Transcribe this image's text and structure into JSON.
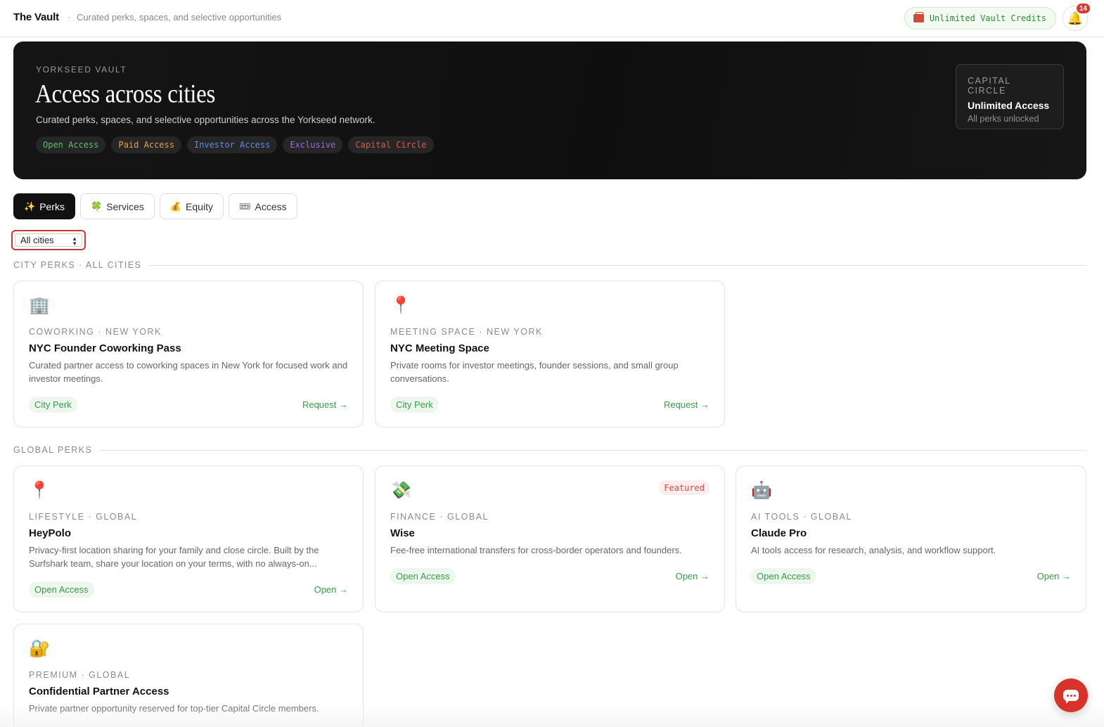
{
  "header": {
    "brand": "The Vault",
    "separator": ".",
    "tagline": "Curated perks, spaces, and selective opportunities",
    "credits_label": "Unlimited Vault Credits",
    "notification_count": "14"
  },
  "hero": {
    "kicker": "YORKSEED VAULT",
    "title": "Access across cities",
    "subtitle": "Curated perks, spaces, and selective opportunities across the Yorkseed network.",
    "tags": [
      "Open Access",
      "Paid Access",
      "Investor Access",
      "Exclusive",
      "Capital Circle"
    ],
    "tier": {
      "label": "CAPITAL CIRCLE",
      "title": "Unlimited Access",
      "subtitle": "All perks unlocked"
    }
  },
  "tabs": [
    {
      "icon": "✨",
      "label": "Perks",
      "active": true
    },
    {
      "icon": "🍀",
      "label": "Services",
      "active": false
    },
    {
      "icon": "💰",
      "label": "Equity",
      "active": false
    },
    {
      "icon": "🎟",
      "label": "Access",
      "active": false
    }
  ],
  "filter": {
    "city_selected": "All cities"
  },
  "sections": {
    "city": "CITY PERKS · ALL CITIES",
    "global": "GLOBAL PERKS"
  },
  "city_perks": [
    {
      "icon": "🏢",
      "category": "COWORKING · NEW YORK",
      "title": "NYC Founder Coworking Pass",
      "description": "Curated partner access to coworking spaces in New York for focused work and investor meetings.",
      "pill": "City Perk",
      "action": "Request →"
    },
    {
      "icon": "📍",
      "category": "MEETING SPACE · NEW YORK",
      "title": "NYC Meeting Space",
      "description": "Private rooms for investor meetings, founder sessions, and small group conversations.",
      "pill": "City Perk",
      "action": "Request →"
    }
  ],
  "global_perks": [
    {
      "icon": "📍",
      "category": "LIFESTYLE · GLOBAL",
      "title": "HeyPolo",
      "description": "Privacy-first location sharing for your family and close circle. Built by the Surfshark team, share your location on your terms, with no always-on...",
      "pill": "Open Access",
      "action": "Open →",
      "featured": ""
    },
    {
      "icon": "💸",
      "category": "FINANCE · GLOBAL",
      "title": "Wise",
      "description": "Fee-free international transfers for cross-border operators and founders.",
      "pill": "Open Access",
      "action": "Open →",
      "featured": "Featured"
    },
    {
      "icon": "🤖",
      "category": "AI TOOLS · GLOBAL",
      "title": "Claude Pro",
      "description": "AI tools access for research, analysis, and workflow support.",
      "pill": "Open Access",
      "action": "Open →",
      "featured": ""
    },
    {
      "icon": "🔐",
      "category": "PREMIUM · GLOBAL",
      "title": "Confidential Partner Access",
      "description": "Private partner opportunity reserved for top-tier Capital Circle members.",
      "pill": "",
      "action": "",
      "featured": ""
    }
  ],
  "colors": {
    "accent_green": "#3a9a47",
    "accent_red": "#d8322b",
    "hero_bg": "#111111"
  }
}
